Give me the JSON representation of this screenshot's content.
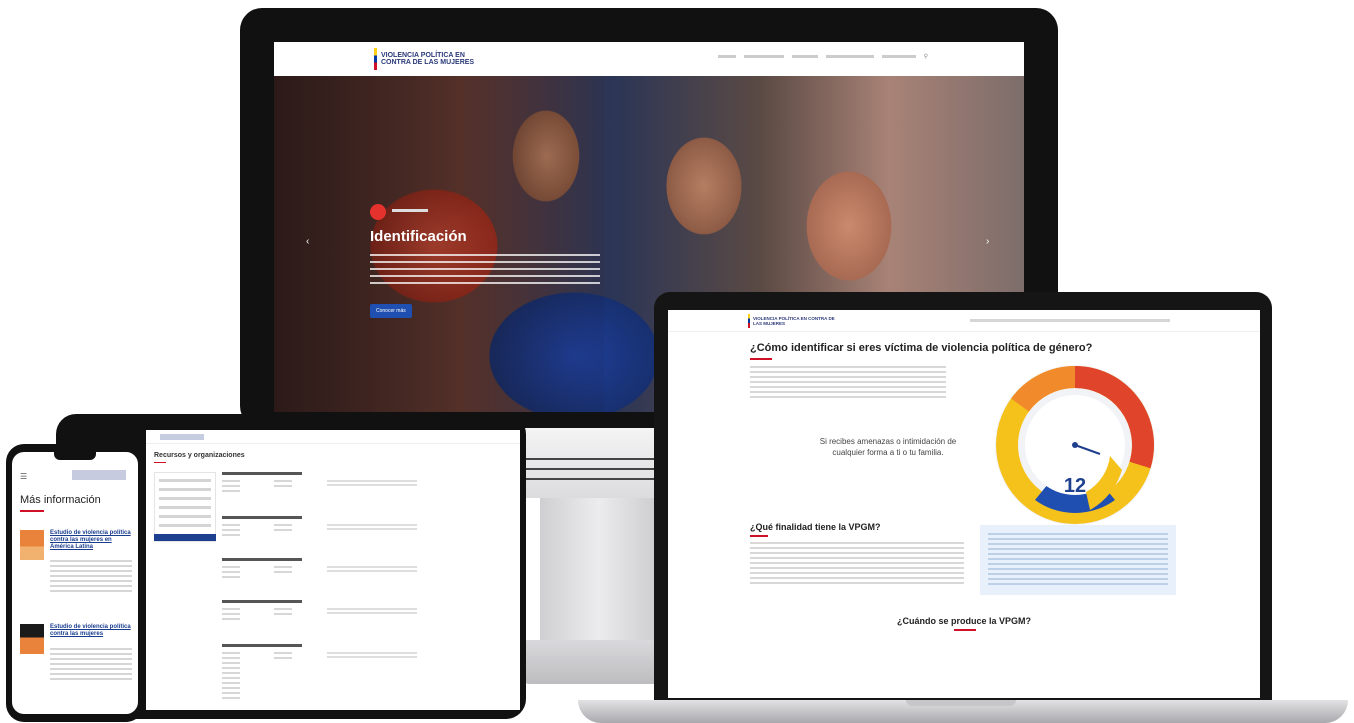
{
  "desktop": {
    "logo_text": "VIOLENCIA POLÍTICA EN CONTRA DE LAS MUJERES",
    "hero": {
      "title": "Identificación",
      "cta": "Conocer más"
    },
    "icons": {
      "search": "search-icon",
      "prev": "chevron-left-icon",
      "next": "chevron-right-icon"
    }
  },
  "phone": {
    "title": "Más información",
    "cards": [
      {
        "title": "Estudio de violencia política contra las mujeres en América Latina"
      },
      {
        "title": "Estudio de violencia política contra las mujeres"
      }
    ],
    "icons": {
      "menu": "hamburger-menu-icon"
    }
  },
  "tablet": {
    "title": "Recursos y organizaciones"
  },
  "laptop": {
    "logo_text": "VIOLENCIA POLÍTICA EN CONTRA DE LAS MUJERES",
    "heading": "¿Cómo identificar si eres víctima de violencia política de género?",
    "quote": "Si recibes amenazas o intimidación de cualquier forma a ti o tu familia.",
    "gauge_value": "12",
    "section_heading": "¿Qué finalidad tiene la VPGM?",
    "section_heading_2": "¿Cuándo se produce la VPGM?"
  },
  "colors": {
    "brand_blue": "#1d3f8f",
    "accent_red": "#ce1126",
    "gauge_red": "#e0442a",
    "gauge_orange": "#f08a2a",
    "gauge_yellow": "#f5c21b"
  }
}
